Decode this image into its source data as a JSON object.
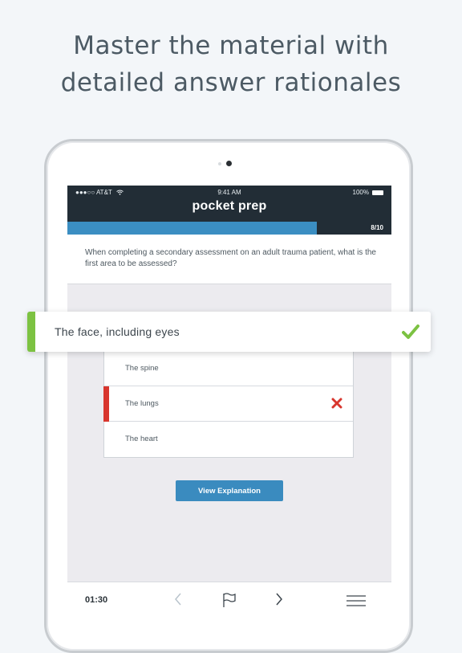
{
  "headline": {
    "line1": "Master the material with",
    "line2": "detailed answer rationales"
  },
  "status_bar": {
    "carrier": "●●●○○ AT&T",
    "time": "9:41 AM",
    "battery": "100%"
  },
  "app": {
    "logo": "pocket prep",
    "progress_label": "8/10",
    "progress_fraction": 0.77
  },
  "question": {
    "text": "When completing a secondary assessment on an adult trauma patient, what is the first area to be assessed?"
  },
  "correct_answer": {
    "text": "The face, including eyes",
    "status": "correct",
    "icon": "check-icon"
  },
  "answers": [
    {
      "text": "The spine",
      "status": "none"
    },
    {
      "text": "The lungs",
      "status": "incorrect",
      "icon": "x-icon"
    },
    {
      "text": "The heart",
      "status": "none"
    }
  ],
  "explain_button": {
    "label": "View Explanation"
  },
  "bottom_bar": {
    "timer": "01:30",
    "icons": [
      "chevron-left-icon",
      "flag-icon",
      "chevron-right-icon",
      "menu-icon"
    ]
  },
  "colors": {
    "header_bg": "#222d36",
    "progress_fill": "#3b8ec2",
    "correct": "#7cc242",
    "incorrect": "#d8362e",
    "button": "#3a8bbf"
  }
}
